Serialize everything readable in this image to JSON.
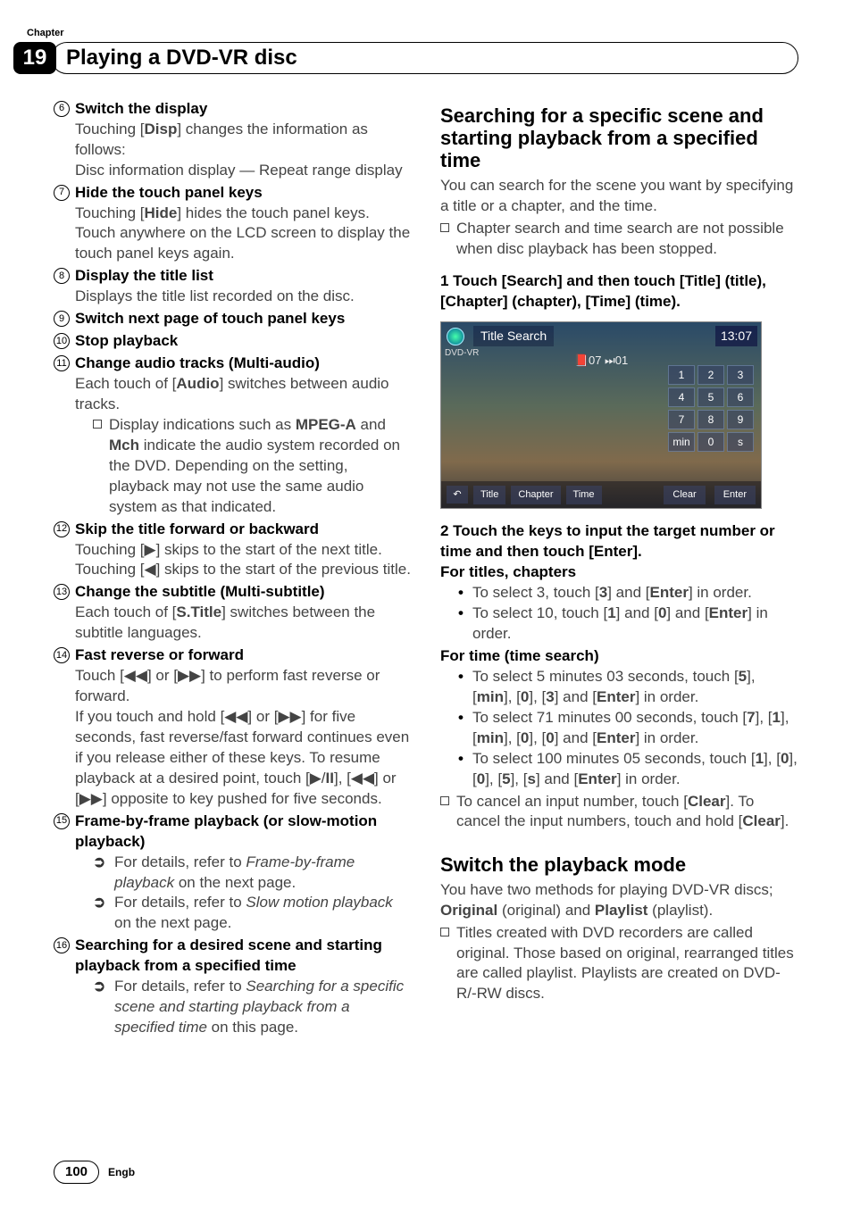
{
  "chapter_label": "Chapter",
  "chapter_number": "19",
  "chapter_title": "Playing a DVD-VR disc",
  "left_items": [
    {
      "num": "6",
      "title": "Switch the display",
      "body": "Touching [<b>Disp</b>] changes the information as follows:<br>Disc information display — Repeat range display"
    },
    {
      "num": "7",
      "title": "Hide the touch panel keys",
      "body": "Touching [<b>Hide</b>] hides the touch panel keys. Touch anywhere on the LCD screen to display the touch panel keys again."
    },
    {
      "num": "8",
      "title": "Display the title list",
      "body": "Displays the title list recorded on the disc."
    },
    {
      "num": "9",
      "title": "Switch next page of touch panel keys",
      "body": ""
    },
    {
      "num": "10",
      "title": "Stop playback",
      "body": ""
    },
    {
      "num": "11",
      "title": "Change audio tracks (Multi-audio)",
      "body": "Each touch of [<b>Audio</b>] switches between audio tracks.",
      "sub_square": "Display indications such as <b>MPEG-A</b> and <b>Mch</b> indicate the audio system recorded on the DVD. Depending on the setting, playback may not use the same audio system as that indicated."
    },
    {
      "num": "12",
      "title": "Skip the title forward or backward",
      "body": "Touching [▶] skips to the start of the next title. Touching [◀] skips to the start of the previous title."
    },
    {
      "num": "13",
      "title": "Change the subtitle (Multi-subtitle)",
      "body": "Each touch of [<b>S.Title</b>] switches between the subtitle languages."
    },
    {
      "num": "14",
      "title": "Fast reverse or forward",
      "body": "Touch [◀◀] or [▶▶] to perform fast reverse or forward.<br>If you touch and hold [◀◀] or [▶▶] for five seconds, fast reverse/fast forward continues even if you release either of these keys. To resume playback at a desired point, touch [▶/<b>II</b>], [◀◀] or [▶▶] opposite to key pushed for five seconds."
    },
    {
      "num": "15",
      "title": "Frame-by-frame playback (or slow-motion playback)",
      "body": "",
      "arrows": [
        "For details, refer to <i>Frame-by-frame playback</i> on the next page.",
        "For details, refer to <i>Slow motion playback</i> on the next page."
      ]
    },
    {
      "num": "16",
      "title": "Searching for a desired scene and starting playback from a specified time",
      "body": "",
      "arrows": [
        "For details, refer to <i>Searching for a specific scene and starting playback from a specified time</i> on this page."
      ]
    }
  ],
  "right": {
    "sec1_title": "Searching for a specific scene and starting playback from a specified time",
    "sec1_intro": "You can search for the scene you want by specifying a title or a chapter, and the time.",
    "sec1_note": "Chapter search and time search are not possible when disc playback has been stopped.",
    "step1": "1    Touch [Search] and then touch [Title] (title), [Chapter] (chapter), [Time] (time).",
    "screenshot": {
      "title": "Title Search",
      "dvd_label": "DVD-VR",
      "center_info": "📕07    ⏭01",
      "time": "13:07",
      "keypad": [
        "1",
        "2",
        "3",
        "4",
        "5",
        "6",
        "7",
        "8",
        "9",
        "min",
        "0",
        "s"
      ],
      "tabs": [
        "Title",
        "Chapter",
        "Time"
      ],
      "clear": "Clear",
      "enter": "Enter"
    },
    "step2_head": "2    Touch the keys to input the target number or time and then touch [Enter].",
    "titles_chapters_label": "For titles, chapters",
    "titles_chapters": [
      "To select 3, touch [<b>3</b>] and [<b>Enter</b>] in order.",
      "To select 10, touch [<b>1</b>] and [<b>0</b>] and [<b>Enter</b>] in order."
    ],
    "time_label": "For time (time search)",
    "time_items": [
      "To select 5 minutes 03 seconds, touch [<b>5</b>], [<b>min</b>], [<b>0</b>], [<b>3</b>] and [<b>Enter</b>] in order.",
      "To select 71 minutes 00 seconds, touch [<b>7</b>], [<b>1</b>], [<b>min</b>], [<b>0</b>], [<b>0</b>] and [<b>Enter</b>] in order.",
      "To select 100 minutes 05 seconds, touch [<b>1</b>], [<b>0</b>], [<b>0</b>], [<b>5</b>], [<b>s</b>] and [<b>Enter</b>] in order."
    ],
    "clear_note": "To cancel an input number, touch [<b>Clear</b>]. To cancel the input numbers, touch and hold [<b>Clear</b>].",
    "sec2_title": "Switch the playback mode",
    "sec2_intro": "You have two methods for playing DVD-VR discs; <b>Original</b> (original) and <b>Playlist</b> (playlist).",
    "sec2_note": "Titles created with DVD recorders are called original. Those based on original, rearranged titles are called playlist. Playlists are created on DVD-R/-RW discs."
  },
  "page_number": "100",
  "lang_label": "Engb"
}
